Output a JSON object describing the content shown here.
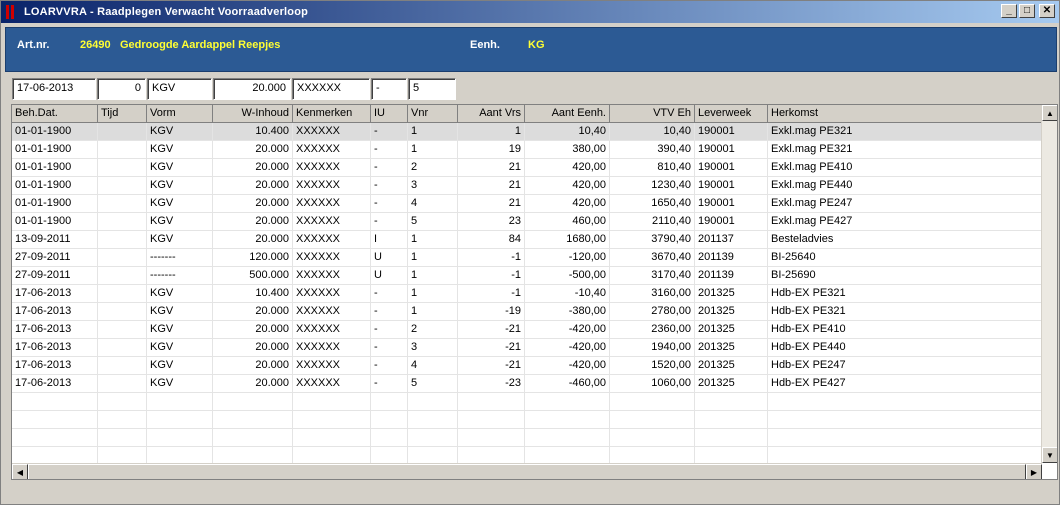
{
  "window": {
    "title": "LOARVVRA - Raadplegen Verwacht Voorraadverloop"
  },
  "header": {
    "art_label": "Art.nr.",
    "art_number": "26490",
    "art_desc": "Gedroogde Aardappel Reepjes",
    "eenh_label": "Eenh.",
    "eenh_value": "KG"
  },
  "filters": [
    "17-06-2013",
    "0",
    "KGV",
    "20.000",
    "XXXXXX",
    "-",
    "5"
  ],
  "table": {
    "columns": [
      "Beh.Dat.",
      "Tijd",
      "Vorm",
      "W-Inhoud",
      "Kenmerken",
      "IU",
      "Vnr",
      "Aant Vrs",
      "Aant Eenh.",
      "VTV Eh",
      "Leverweek",
      "Herkomst"
    ],
    "rows": [
      [
        "01-01-1900",
        "",
        "KGV",
        "10.400",
        "XXXXXX",
        "-",
        "1",
        "1",
        "10,40",
        "10,40",
        "190001",
        "Exkl.mag PE321"
      ],
      [
        "01-01-1900",
        "",
        "KGV",
        "20.000",
        "XXXXXX",
        "-",
        "1",
        "19",
        "380,00",
        "390,40",
        "190001",
        "Exkl.mag PE321"
      ],
      [
        "01-01-1900",
        "",
        "KGV",
        "20.000",
        "XXXXXX",
        "-",
        "2",
        "21",
        "420,00",
        "810,40",
        "190001",
        "Exkl.mag PE410"
      ],
      [
        "01-01-1900",
        "",
        "KGV",
        "20.000",
        "XXXXXX",
        "-",
        "3",
        "21",
        "420,00",
        "1230,40",
        "190001",
        "Exkl.mag PE440"
      ],
      [
        "01-01-1900",
        "",
        "KGV",
        "20.000",
        "XXXXXX",
        "-",
        "4",
        "21",
        "420,00",
        "1650,40",
        "190001",
        "Exkl.mag PE247"
      ],
      [
        "01-01-1900",
        "",
        "KGV",
        "20.000",
        "XXXXXX",
        "-",
        "5",
        "23",
        "460,00",
        "2110,40",
        "190001",
        "Exkl.mag PE427"
      ],
      [
        "13-09-2011",
        "",
        "KGV",
        "20.000",
        "XXXXXX",
        "I",
        "1",
        "84",
        "1680,00",
        "3790,40",
        "201137",
        "Besteladvies"
      ],
      [
        "27-09-2011",
        "",
        "-------",
        "120.000",
        "XXXXXX",
        "U",
        "1",
        "-1",
        "-120,00",
        "3670,40",
        "201139",
        "BI-25640"
      ],
      [
        "27-09-2011",
        "",
        "-------",
        "500.000",
        "XXXXXX",
        "U",
        "1",
        "-1",
        "-500,00",
        "3170,40",
        "201139",
        "BI-25690"
      ],
      [
        "17-06-2013",
        "",
        "KGV",
        "10.400",
        "XXXXXX",
        "-",
        "1",
        "-1",
        "-10,40",
        "3160,00",
        "201325",
        "Hdb-EX PE321"
      ],
      [
        "17-06-2013",
        "",
        "KGV",
        "20.000",
        "XXXXXX",
        "-",
        "1",
        "-19",
        "-380,00",
        "2780,00",
        "201325",
        "Hdb-EX PE321"
      ],
      [
        "17-06-2013",
        "",
        "KGV",
        "20.000",
        "XXXXXX",
        "-",
        "2",
        "-21",
        "-420,00",
        "2360,00",
        "201325",
        "Hdb-EX PE410"
      ],
      [
        "17-06-2013",
        "",
        "KGV",
        "20.000",
        "XXXXXX",
        "-",
        "3",
        "-21",
        "-420,00",
        "1940,00",
        "201325",
        "Hdb-EX PE440"
      ],
      [
        "17-06-2013",
        "",
        "KGV",
        "20.000",
        "XXXXXX",
        "-",
        "4",
        "-21",
        "-420,00",
        "1520,00",
        "201325",
        "Hdb-EX PE247"
      ],
      [
        "17-06-2013",
        "",
        "KGV",
        "20.000",
        "XXXXXX",
        "-",
        "5",
        "-23",
        "-460,00",
        "1060,00",
        "201325",
        "Hdb-EX PE427"
      ]
    ]
  },
  "colors": {
    "title_start": "#0a246a",
    "title_end": "#a6caf0",
    "header_bg": "#2c5a94",
    "header_value": "#ffff33"
  }
}
